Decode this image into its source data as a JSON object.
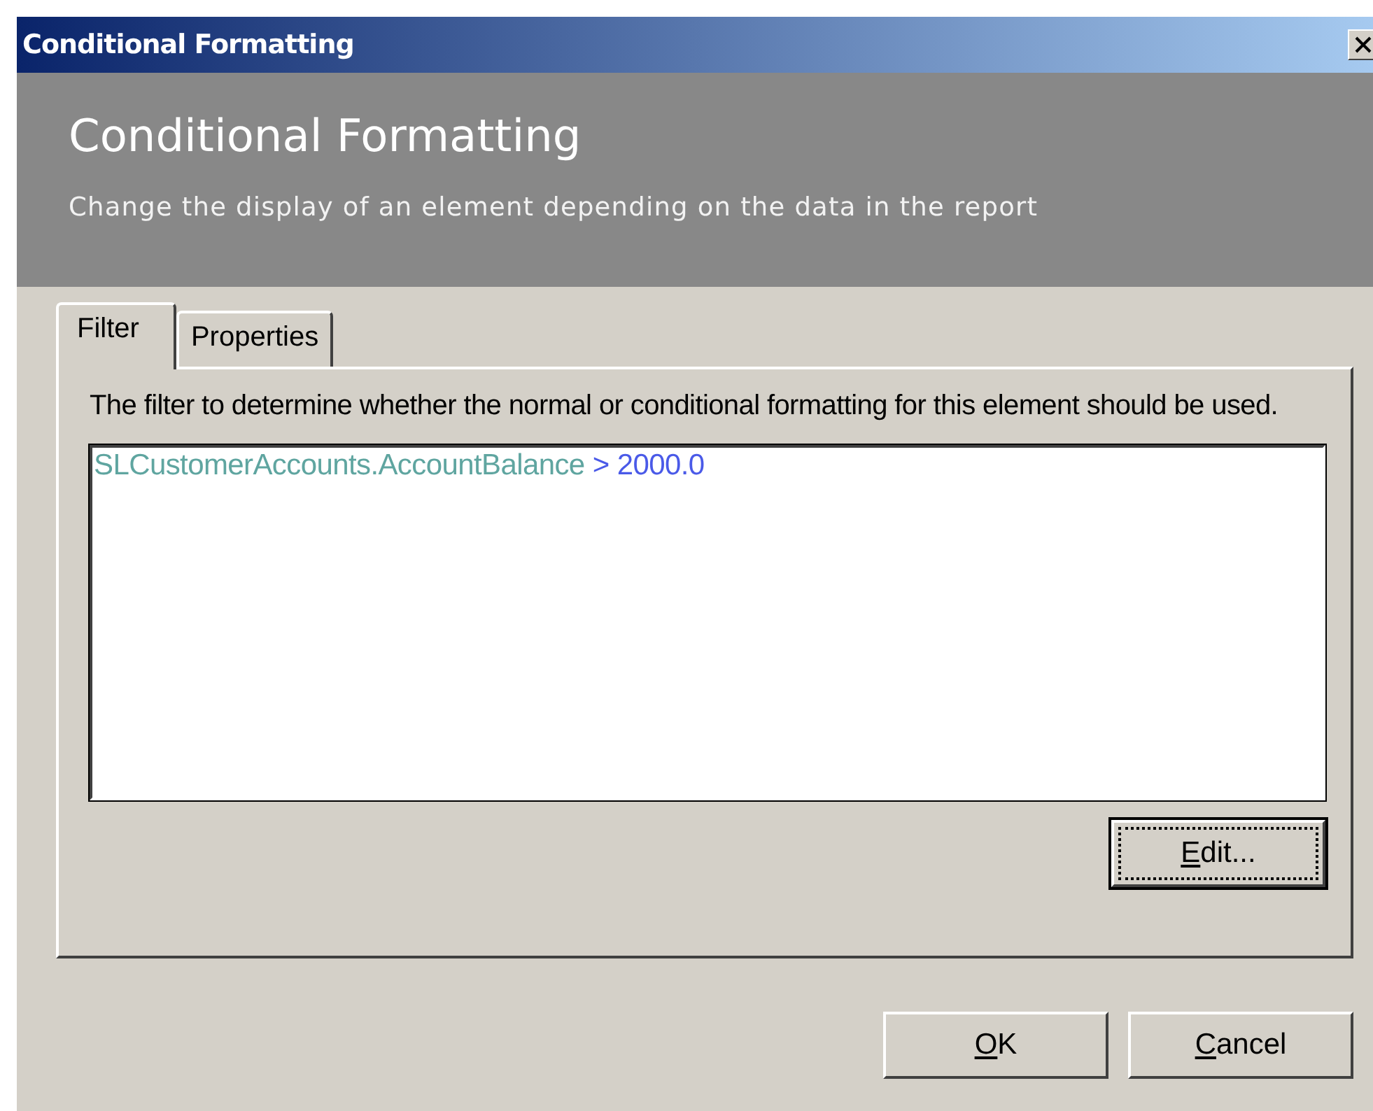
{
  "window": {
    "title": "Conditional Formatting"
  },
  "header": {
    "title": "Conditional Formatting",
    "subtitle": "Change the display of an element depending on the data in the report"
  },
  "tabs": [
    {
      "label": "Filter",
      "selected": true
    },
    {
      "label": "Properties",
      "selected": false
    }
  ],
  "filter_panel": {
    "description": "The filter to determine whether the normal or conditional formatting for this element should be used.",
    "expression": [
      {
        "text": "SLCustomerAccounts.AccountBalance",
        "color": "#5fa5a0"
      },
      {
        "text": "> 2000.0",
        "color": "#4a5ae8"
      }
    ],
    "edit_button": {
      "label": "Edit...",
      "underline_first": true,
      "focused": true
    }
  },
  "buttons": [
    {
      "label": "OK",
      "underline_first": true,
      "focused": false
    },
    {
      "label": "Cancel",
      "underline_first": true,
      "focused": false
    }
  ]
}
